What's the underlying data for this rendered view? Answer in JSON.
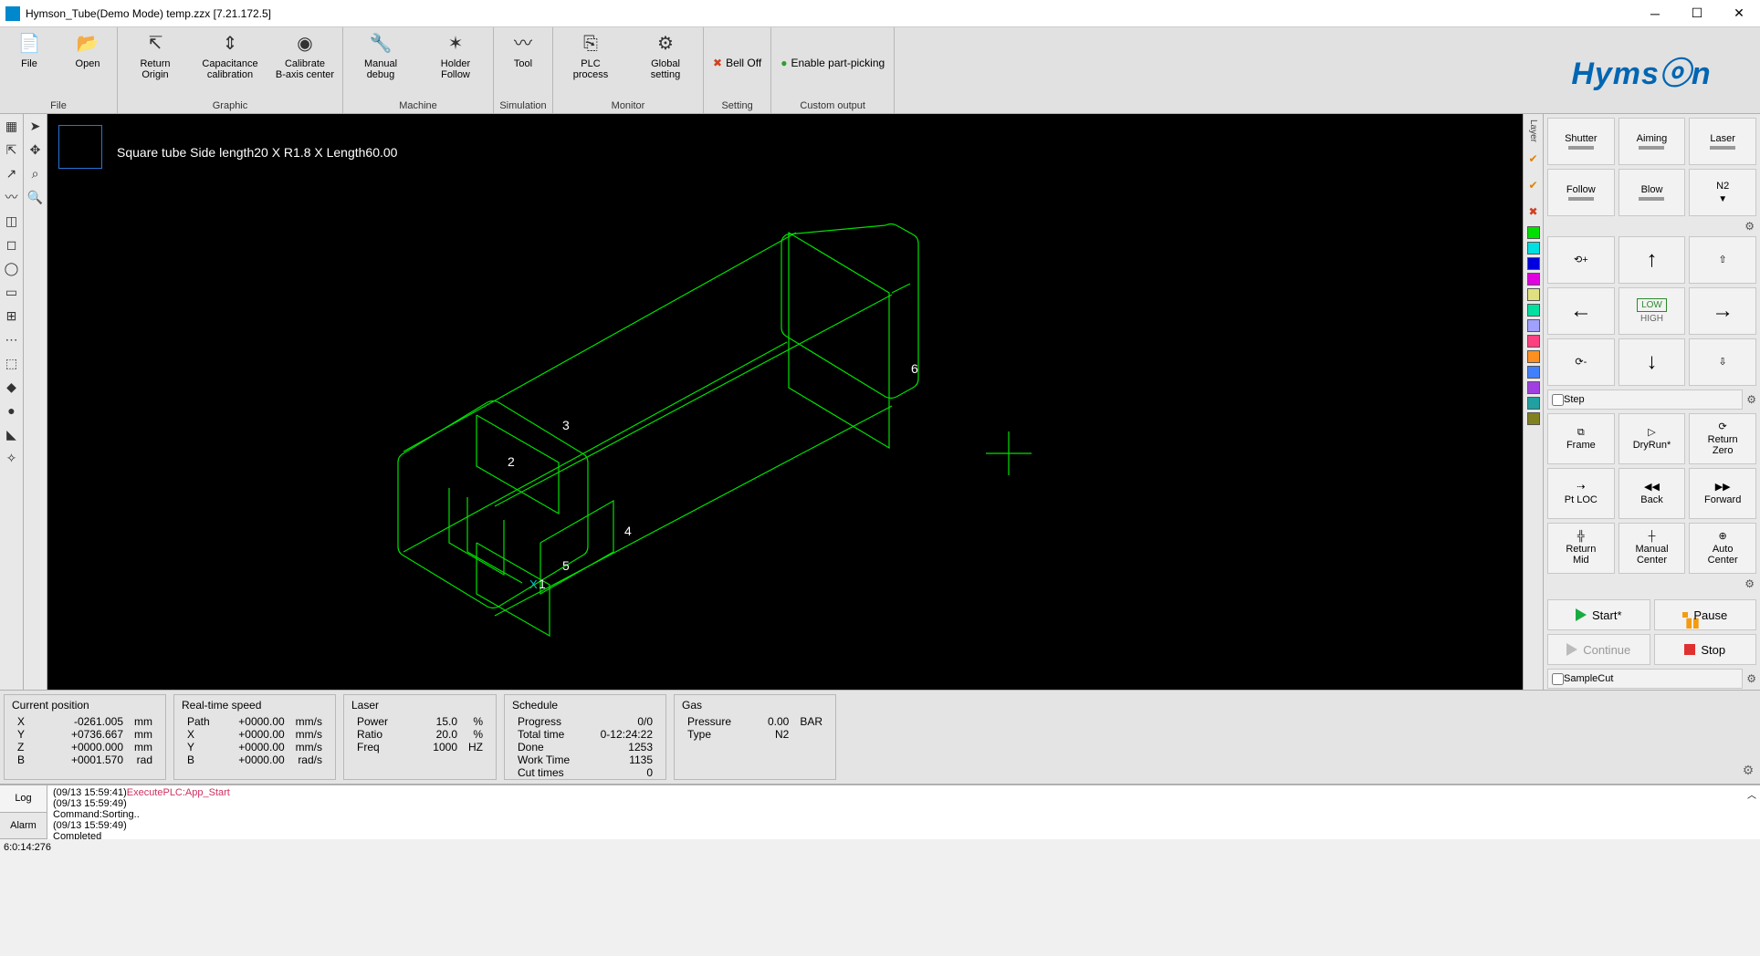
{
  "title": "Hymson_Tube(Demo Mode) temp.zzx  [7.21.172.5]",
  "logo": "Hymsⓞn",
  "ribbon": {
    "groups": [
      {
        "label": "File",
        "buttons": [
          {
            "name": "file-button",
            "text": "File",
            "ico": "📄"
          },
          {
            "name": "open-button",
            "text": "Open",
            "ico": "📂"
          }
        ]
      },
      {
        "label": "Graphic",
        "buttons": [
          {
            "name": "return-origin-button",
            "text": "Return\nOrigin",
            "ico": "↸"
          },
          {
            "name": "capacitance-calibration-button",
            "text": "Capacitance\ncalibration",
            "ico": "⇕"
          },
          {
            "name": "calibrate-b-axis-button",
            "text": "Calibrate\nB-axis center",
            "ico": "◉"
          }
        ]
      },
      {
        "label": "Machine",
        "buttons": [
          {
            "name": "manual-debug-button",
            "text": "Manual\ndebug",
            "ico": "🔧"
          },
          {
            "name": "holder-follow-button",
            "text": "Holder\nFollow",
            "ico": "✶"
          }
        ]
      },
      {
        "label": "Simulation",
        "buttons": [
          {
            "name": "tool-button",
            "text": "Tool",
            "ico": "〰"
          }
        ]
      },
      {
        "label": "Monitor",
        "buttons": [
          {
            "name": "plc-process-button",
            "text": "PLC\nprocess",
            "ico": "⎘"
          },
          {
            "name": "global-setting-button",
            "text": "Global\nsetting",
            "ico": "⚙"
          }
        ]
      },
      {
        "label": "Setting",
        "checks": [
          {
            "name": "bell-off-check",
            "text": "Bell Off",
            "mark": "✖",
            "color": "#d04020"
          }
        ]
      },
      {
        "label": "Custom output",
        "checks": [
          {
            "name": "enable-part-picking-check",
            "text": "Enable part-picking",
            "mark": "●",
            "color": "#2aa02a"
          }
        ]
      }
    ]
  },
  "canvas_info": "Square tube Side length20 X R1.8 X Length60.00",
  "node_labels": [
    "1",
    "2",
    "3",
    "4",
    "5",
    "6"
  ],
  "layer_vert_label": "Layer",
  "layer_checks": [
    "✔",
    "✔",
    "✖"
  ],
  "layer_colors": [
    "#00e000",
    "#00e0e0",
    "#0000e0",
    "#e000e0",
    "#e0e080",
    "#00e0a0",
    "#a0a0ff",
    "#ff4080",
    "#ff9020",
    "#4080ff",
    "#a040e0",
    "#20a0a0",
    "#808020"
  ],
  "rp": {
    "row1": [
      "Shutter",
      "Aiming",
      "Laser"
    ],
    "row2": [
      "Follow",
      "Blow",
      "N2"
    ],
    "lowhigh": [
      "LOW",
      "HIGH"
    ],
    "jog_icons": {
      "ccw": "⟲+",
      "up": "↑",
      "z_up": "⇧",
      "left": "←",
      "right": "→",
      "cw": "⟳-",
      "down": "↓",
      "z_down": "⇩"
    },
    "step": "Step",
    "row_ops1": [
      {
        "name": "frame-button",
        "text": "Frame",
        "ico": "⧉"
      },
      {
        "name": "dryrun-button",
        "text": "DryRun*",
        "ico": "▷"
      },
      {
        "name": "return-zero-button",
        "text": "Return\nZero",
        "ico": "⟳"
      }
    ],
    "row_ops2": [
      {
        "name": "ptloc-button",
        "text": "Pt LOC",
        "ico": "⇢"
      },
      {
        "name": "back-button",
        "text": "Back",
        "ico": "◀◀"
      },
      {
        "name": "forward-button",
        "text": "Forward",
        "ico": "▶▶"
      }
    ],
    "row_ops3": [
      {
        "name": "return-mid-button",
        "text": "Return\nMid",
        "ico": "╬"
      },
      {
        "name": "manual-center-button",
        "text": "Manual\nCenter",
        "ico": "┼"
      },
      {
        "name": "auto-center-button",
        "text": "Auto\nCenter",
        "ico": "⊕"
      }
    ],
    "run": {
      "start": "Start*",
      "pause": "Pause",
      "continue": "Continue",
      "stop": "Stop"
    },
    "samplecut": "SampleCut"
  },
  "status": {
    "cp": {
      "hdr": "Current position",
      "rows": [
        [
          "X",
          "-0261.005",
          "mm"
        ],
        [
          "Y",
          "+0736.667",
          "mm"
        ],
        [
          "Z",
          "+0000.000",
          "mm"
        ],
        [
          "B",
          "+0001.570",
          "rad"
        ]
      ]
    },
    "speed": {
      "hdr": "Real-time speed",
      "rows": [
        [
          "Path",
          "+0000.00",
          "mm/s"
        ],
        [
          "X",
          "+0000.00",
          "mm/s"
        ],
        [
          "Y",
          "+0000.00",
          "mm/s"
        ],
        [
          "B",
          "+0000.00",
          "rad/s"
        ]
      ]
    },
    "laser": {
      "hdr": "Laser",
      "rows": [
        [
          "Power",
          "15.0",
          "%"
        ],
        [
          "Ratio",
          "20.0",
          "%"
        ],
        [
          "Freq",
          "1000",
          "HZ"
        ]
      ]
    },
    "sched": {
      "hdr": "Schedule",
      "rows": [
        [
          "Progress",
          "0/0"
        ],
        [
          "Total time",
          "0-12:24:22"
        ],
        [
          "Done",
          "1253"
        ],
        [
          "Work Time",
          "1135"
        ],
        [
          "Cut times",
          "0"
        ]
      ]
    },
    "gas": {
      "hdr": "Gas",
      "rows": [
        [
          "Pressure",
          "0.00",
          "BAR"
        ],
        [
          "Type",
          "N2",
          ""
        ]
      ]
    }
  },
  "log": {
    "tabs": [
      "Log",
      "Alarm"
    ],
    "lines": [
      {
        "ts": "(09/13 15:59:41)",
        "msg": "ExecutePLC:App_Start",
        "color": "#d03060"
      },
      {
        "ts": "(09/13 15:59:49)",
        "msg": "",
        "color": "#000"
      },
      {
        "ts": "",
        "msg": "Command:Sorting..",
        "color": "#000"
      },
      {
        "ts": "(09/13 15:59:49)",
        "msg": "",
        "color": "#000"
      },
      {
        "ts": "",
        "msg": "Completed",
        "color": "#000"
      }
    ]
  },
  "footer": "6:0:14:276"
}
